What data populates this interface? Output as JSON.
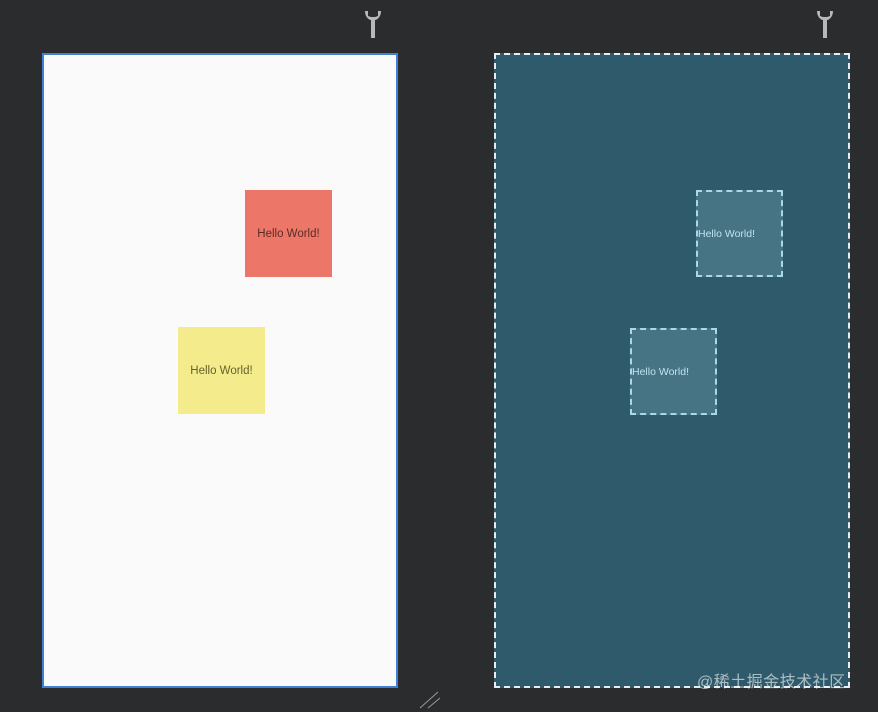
{
  "icons": {
    "left_toolbar_icon": "wrench-icon",
    "right_toolbar_icon": "wrench-icon",
    "resize_icon": "resize-handle-icon"
  },
  "design": {
    "boxes": [
      {
        "label": "Hello World!",
        "color": "#ec7768"
      },
      {
        "label": "Hello World!",
        "color": "#f4ec8c"
      }
    ],
    "background": "#fafafa",
    "selection_color": "#3f7fd6"
  },
  "blueprint": {
    "boxes": [
      {
        "label": "Hello World!"
      },
      {
        "label": "Hello World!"
      }
    ],
    "background": "#2f5a6b"
  },
  "watermark": "@稀土掘金技术社区"
}
